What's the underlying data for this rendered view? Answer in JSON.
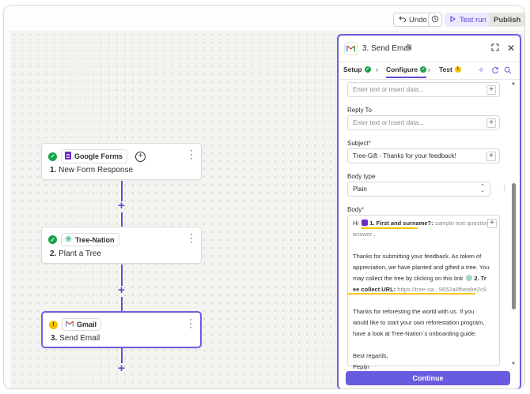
{
  "toolbar": {
    "undo_label": "Undo",
    "test_run_label": "Test run",
    "publish_label": "Publish"
  },
  "workflow": {
    "steps": [
      {
        "app": "Google Forms",
        "number": "1.",
        "title": "New Form Response",
        "status": "ok"
      },
      {
        "app": "Tree-Nation",
        "number": "2.",
        "title": "Plant a Tree",
        "status": "ok"
      },
      {
        "app": "Gmail",
        "number": "3.",
        "title": "Send Email",
        "status": "warning"
      }
    ]
  },
  "panel": {
    "title": "3. Send Email",
    "tabs": [
      {
        "label": "Setup",
        "status": "ok"
      },
      {
        "label": "Configure",
        "status": "ok",
        "active": true
      },
      {
        "label": "Test",
        "status": "warning"
      }
    ],
    "top_field_placeholder": "Enter text or insert data...",
    "reply_to": {
      "label": "Reply To",
      "placeholder": "Enter text or insert data..."
    },
    "subject": {
      "label": "Subject",
      "value": "Tree-Gift - Thanks for your feedback!"
    },
    "body_type": {
      "label": "Body type",
      "value": "Plain"
    },
    "body": {
      "label": "Body",
      "greeting": "Hi",
      "pill_1_label": "1. First and surname?:",
      "pill_1_value": "sample text question",
      "pill_1_value_2": "answer",
      "para_1_line_1": "Thanks for submitting your feedback. As token of",
      "para_1_line_2": "appreciation, we have planted and gifted a tree. You",
      "para_1_line_3": "may collect the tree by clicking on this link",
      "pill_2_label_a": "2. Tr",
      "pill_2_label_b": "ee collect URL:",
      "pill_2_value": "https://tree-na...9652a8fbeabe2c8",
      "para_2_line_1": "Thanks for reforesting the world with us. If you",
      "para_2_line_2": "would like to start your own reforestation program,",
      "para_2_line_3": "have a look at Tree-Nation´s onboarding guide.",
      "sign_off": "Best regards,",
      "signature": "Pepijn"
    },
    "continue_label": "Continue"
  },
  "colors": {
    "accent": "#695be0",
    "success": "#16a34a",
    "warning": "#f5c100",
    "highlight": "#f5c700"
  },
  "icons": [
    "undo-icon",
    "history-icon",
    "play-icon",
    "check-icon",
    "warning-icon",
    "google-forms-icon",
    "tree-nation-icon",
    "gmail-icon",
    "more-icon",
    "plus-icon",
    "pencil-icon",
    "expand-icon",
    "close-icon",
    "chevron-right-icon",
    "sparkle-icon",
    "refresh-icon",
    "search-icon",
    "select-arrows-icon"
  ]
}
